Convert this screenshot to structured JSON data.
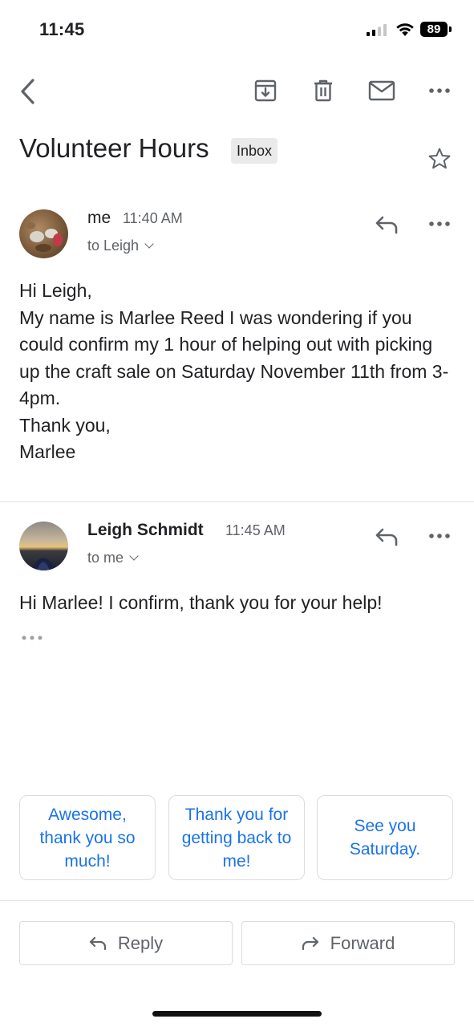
{
  "status_bar": {
    "time": "11:45",
    "battery": "89"
  },
  "toolbar": {
    "icons": [
      "back-icon",
      "archive-icon",
      "trash-icon",
      "mail-icon",
      "more-icon"
    ]
  },
  "thread": {
    "subject": "Volunteer Hours",
    "label": "Inbox"
  },
  "messages": [
    {
      "sender": "me",
      "time": "11:40 AM",
      "recipient": "to Leigh",
      "body": "Hi Leigh,\nMy name is Marlee Reed I was wondering if you could confirm my 1 hour of helping out with picking up the craft sale on Saturday November 11th from 3-4pm.\nThank you,\nMarlee"
    },
    {
      "sender": "Leigh Schmidt",
      "time": "11:45 AM",
      "recipient": "to me",
      "body": "Hi Marlee!  I confirm, thank you for your help!"
    }
  ],
  "smart_replies": [
    "Awesome, thank you so much!",
    "Thank you for getting back to me!",
    "See you Saturday."
  ],
  "actions": {
    "reply": "Reply",
    "forward": "Forward"
  },
  "colors": {
    "accent": "#1a73e8",
    "text": "#202124",
    "secondary": "#5f6368"
  }
}
